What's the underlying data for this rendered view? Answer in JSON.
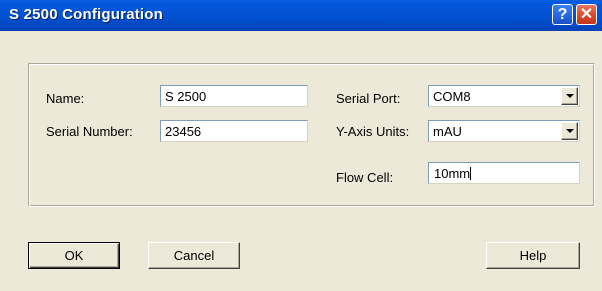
{
  "window": {
    "title": "S 2500 Configuration",
    "help_glyph": "?",
    "close_glyph": "✕"
  },
  "form": {
    "name": {
      "label": "Name:",
      "value": "S 2500"
    },
    "serial_number": {
      "label": "Serial Number:",
      "value": "23456"
    },
    "serial_port": {
      "label": "Serial Port:",
      "value": "COM8"
    },
    "y_axis_units": {
      "label": "Y-Axis Units:",
      "value": "mAU"
    },
    "flow_cell": {
      "label": "Flow Cell:",
      "value": "10mm"
    }
  },
  "buttons": {
    "ok": "OK",
    "cancel": "Cancel",
    "help": "Help"
  },
  "colors": {
    "titlebar": "#0352d2",
    "dialog_bg": "#ece9d8",
    "close_button": "#d8462a"
  }
}
